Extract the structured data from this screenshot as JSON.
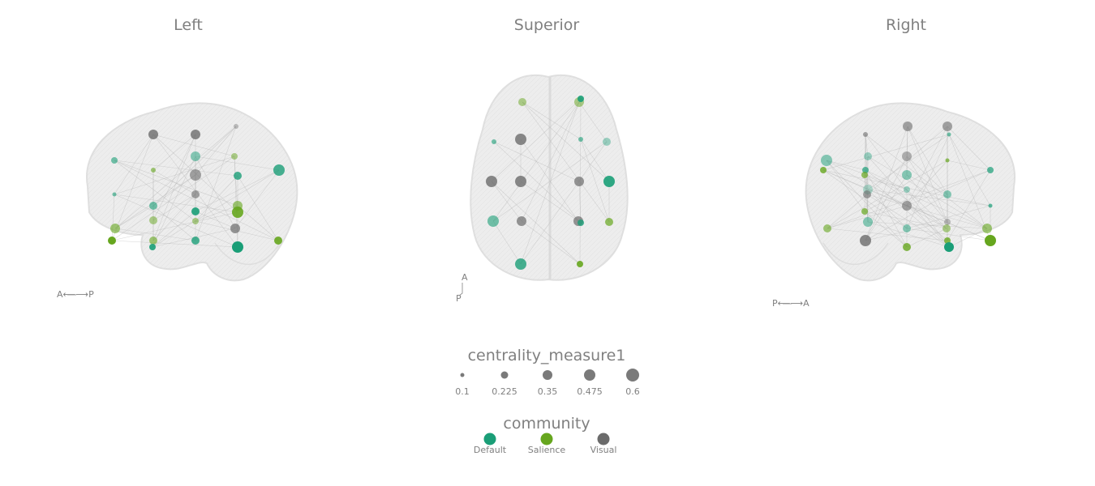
{
  "views": [
    {
      "title": "Left",
      "orientation": "A⟵⟶P"
    },
    {
      "title": "Superior",
      "orientation_top": "A",
      "orientation_bottom": "P"
    },
    {
      "title": "Right",
      "orientation": "P⟵⟶A"
    }
  ],
  "legend": {
    "size_title": "centrality_measure1",
    "size_values": [
      "0.1",
      "0.225",
      "0.35",
      "0.475",
      "0.6"
    ],
    "community_title": "community",
    "communities": [
      {
        "name": "Default",
        "color": "#1a9e77"
      },
      {
        "name": "Salience",
        "color": "#66a61e"
      },
      {
        "name": "Visual",
        "color": "#6b6b6b"
      }
    ]
  }
}
